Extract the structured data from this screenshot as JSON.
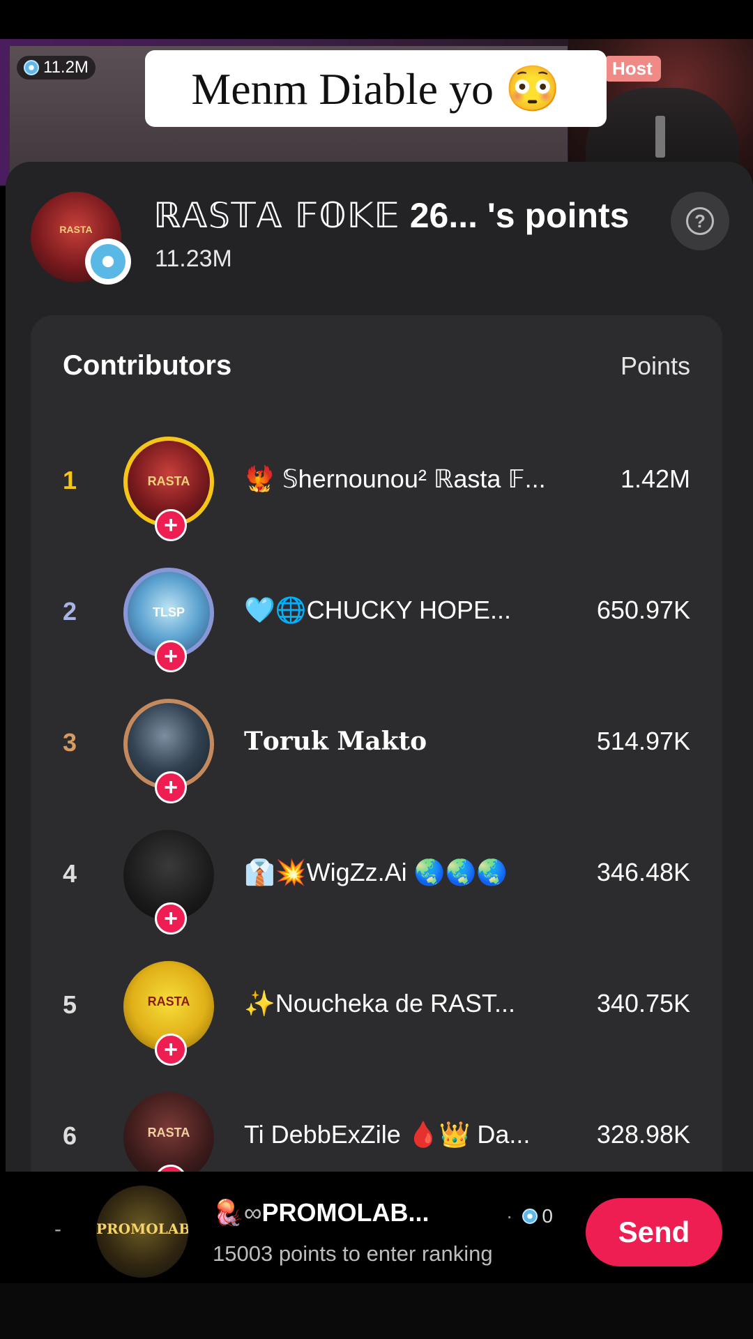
{
  "stream": {
    "coins": "11.2M",
    "host_label": "Host",
    "caption": "Menm Diable yo 😳"
  },
  "owner": {
    "title_deco": "ℝ𝔸𝕊𝕋𝔸 𝔽𝕆𝕂𝔼",
    "title_rest": " 26... 's points",
    "points": "11.23M",
    "help_icon": "?"
  },
  "list": {
    "header_left": "Contributors",
    "header_right": "Points",
    "rows": [
      {
        "rank": "1",
        "rank_color": "#f5c518",
        "name": "🐦‍🔥 𝕊hernounou² ℝasta 𝔽...",
        "points": "1.42M",
        "ring": "#f5c518",
        "avatar_text": "RASTA",
        "avatar_bg": "radial-gradient(circle at 50% 40%, #c8403a 0%, #7a1a1e 55%, #2e0e10 100%)",
        "avatar_fg": "#f6d27a"
      },
      {
        "rank": "2",
        "rank_color": "#a9b4e6",
        "name": "🩵🌐CHUCKY HOPE...",
        "points": "650.97K",
        "ring": "#8a97d6",
        "avatar_text": "TLSP",
        "avatar_bg": "radial-gradient(circle at 50% 45%, #bfe4f4 0%, #5ca2d0 50%, #2b4f7a 100%)",
        "avatar_fg": "#ffffff"
      },
      {
        "rank": "3",
        "rank_color": "#d79a62",
        "name": "𝐓𝐨𝐫𝐮𝐤  𝐌𝐚𝐤𝐭𝐨",
        "points": "514.97K",
        "ring": "#c48a5e",
        "avatar_text": "",
        "avatar_bg": "radial-gradient(circle at 45% 40%, #7c8ea0 0%, #324252 50%, #141c24 100%)",
        "avatar_fg": "#ffffff"
      },
      {
        "rank": "4",
        "rank_color": "#dddddd",
        "name": "👔💥WigZz.Ai 🌏🌏🌏",
        "points": "346.48K",
        "ring": "",
        "avatar_text": "",
        "avatar_bg": "radial-gradient(circle at 50% 40%, #3a3a3a 0%, #1a1a1a 60%, #0a0a0a 100%)",
        "avatar_fg": "#ffffff"
      },
      {
        "rank": "5",
        "rank_color": "#dddddd",
        "name": "✨Noucheka de RAST...",
        "points": "340.75K",
        "ring": "",
        "avatar_text": "RASTA",
        "avatar_bg": "radial-gradient(circle at 50% 45%, #f7de3a 0%, #e0b018 55%, #7a5a08 100%)",
        "avatar_fg": "#8a1a10"
      },
      {
        "rank": "6",
        "rank_color": "#dddddd",
        "name": "Ti DebbExZile 🩸👑 Da...",
        "points": "328.98K",
        "ring": "",
        "avatar_text": "RASTA",
        "avatar_bg": "radial-gradient(circle at 50% 40%, #7a3a36 0%, #3a1a1a 60%, #141010 100%)",
        "avatar_fg": "#f0d0a0"
      }
    ]
  },
  "me": {
    "dash": "-",
    "avatar_text": "PROMOLAB",
    "name_icon": "🪼",
    "name_inf": "∞",
    "name": "PROMOLAB...",
    "gems": "0",
    "hint": "15003 points to enter ranking",
    "send_label": "Send"
  }
}
